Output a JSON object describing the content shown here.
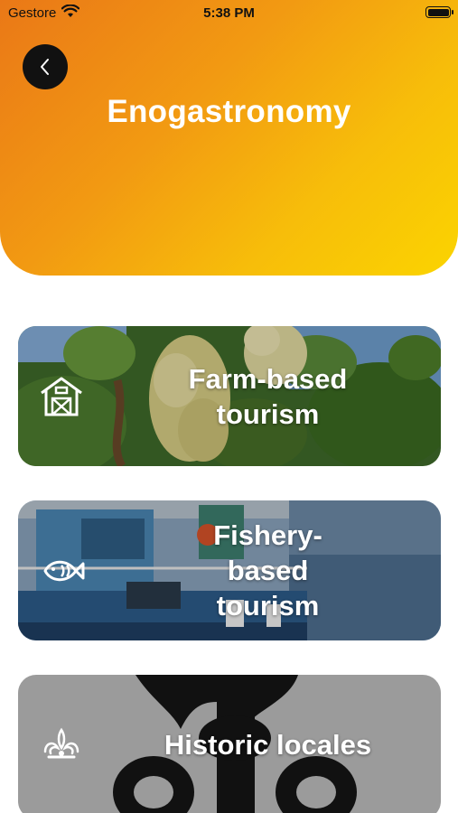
{
  "status_bar": {
    "carrier": "Gestore",
    "time": "5:38 PM"
  },
  "header": {
    "title": "Enogastronomy",
    "gradient_start": "#ea7817",
    "gradient_end": "#fbd400",
    "back_icon": "chevron-left-icon"
  },
  "cards": [
    {
      "label": "Farm-based tourism",
      "icon": "barn-icon"
    },
    {
      "label": "Fishery-based tourism",
      "icon": "fish-icon"
    },
    {
      "label": "Historic locales",
      "icon": "ornament-icon"
    }
  ]
}
